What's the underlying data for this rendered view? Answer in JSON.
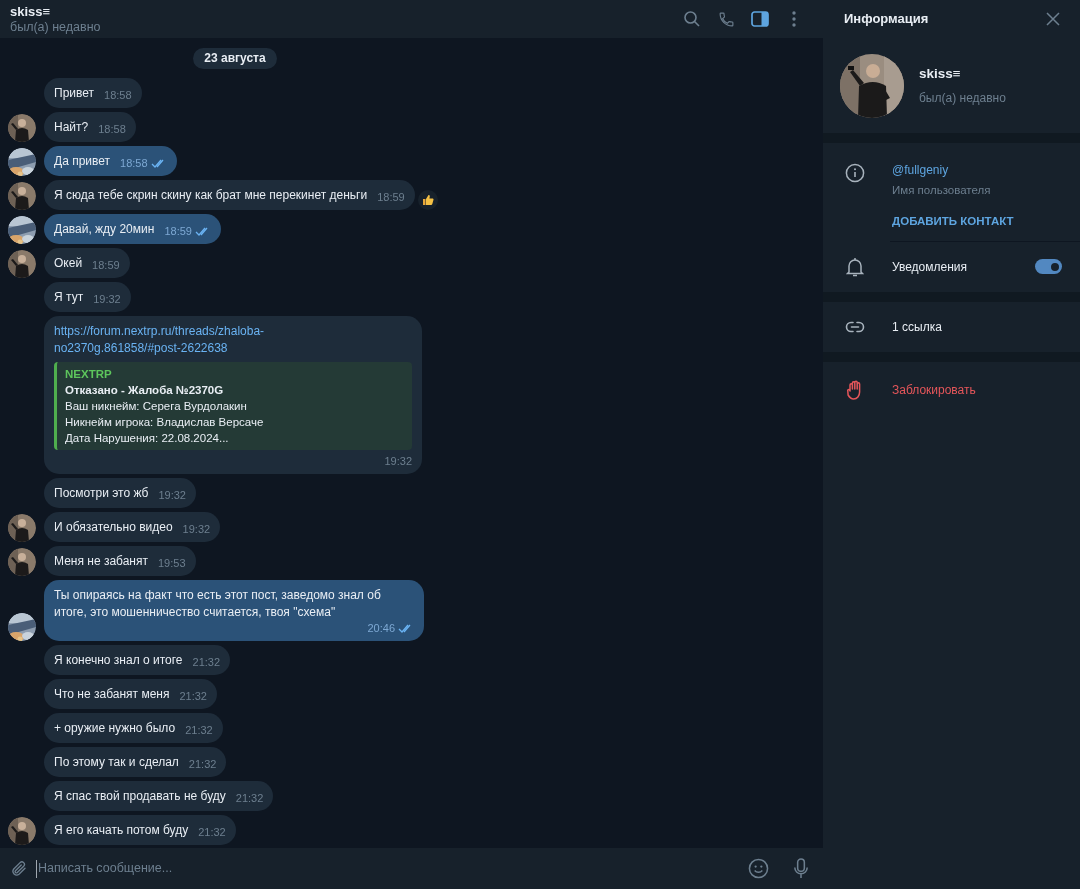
{
  "chat": {
    "title": "skiss≡",
    "status": "был(а) недавно",
    "info_panel_open": true
  },
  "date_badge": "23 августа",
  "messages": [
    {
      "kind": "in",
      "text": "Привет",
      "time": "18:58",
      "avatar": false
    },
    {
      "kind": "in",
      "text": "Найт?",
      "time": "18:58",
      "avatar": true
    },
    {
      "kind": "out",
      "text": "Да привет",
      "time": "18:58",
      "avatar": true,
      "read": true
    },
    {
      "kind": "in",
      "text": "Я сюда тебе скрин скину как брат мне перекинет деньги",
      "time": "18:59",
      "avatar": true,
      "reacted": true
    },
    {
      "kind": "out",
      "text": "Давай, жду 20мин",
      "time": "18:59",
      "avatar": true,
      "read": true
    },
    {
      "kind": "in",
      "text": "Окей",
      "time": "18:59",
      "avatar": true
    },
    {
      "kind": "in",
      "text": "Я тут",
      "time": "19:32",
      "avatar": false
    },
    {
      "kind": "link",
      "url": "https://forum.nextrp.ru/threads/zhaloba-no2370g.861858/#post-2622638",
      "preview": {
        "site": "NEXTRP",
        "title": "Отказано - Жалоба №2370G",
        "lines": [
          "Ваш никнейм: Серега Вурдолакин",
          "Никнейм игрока: Владислав Версаче",
          "Дата Нарушения: 22.08.2024..."
        ]
      },
      "time": "19:32",
      "avatar": false
    },
    {
      "kind": "in",
      "text": "Посмотри это жб",
      "time": "19:32",
      "avatar": false
    },
    {
      "kind": "in",
      "text": "И обязательно видео",
      "time": "19:32",
      "avatar": true
    },
    {
      "kind": "in",
      "text": "Меня не забанят",
      "time": "19:53",
      "avatar": true
    },
    {
      "kind": "out",
      "text": "Ты опираясь на факт что есть этот пост, заведомо знал об итоге, это мошенничество считается, твоя \"схема\"",
      "time": "20:46",
      "avatar": true,
      "read": true
    },
    {
      "kind": "in",
      "text": "Я конечно знал о итоге",
      "time": "21:32",
      "avatar": false
    },
    {
      "kind": "in",
      "text": "Что не забанят меня",
      "time": "21:32",
      "avatar": false
    },
    {
      "kind": "in",
      "text": "+ оружие нужно было",
      "time": "21:32",
      "avatar": false
    },
    {
      "kind": "in",
      "text": "По этому так и сделал",
      "time": "21:32",
      "avatar": false
    },
    {
      "kind": "in",
      "text": "Я спас твой продавать не буду",
      "time": "21:32",
      "avatar": false
    },
    {
      "kind": "in",
      "text": "Я его качать потом буду",
      "time": "21:32",
      "avatar": true
    }
  ],
  "composer": {
    "placeholder": "Написать сообщение..."
  },
  "info_panel": {
    "title": "Информация",
    "name": "skiss≡",
    "status": "был(а) недавно",
    "username": "@fullgeniy",
    "username_label": "Имя пользователя",
    "add_contact": "ДОБАВИТЬ КОНТАКТ",
    "notifications": {
      "label": "Уведомления",
      "on": true
    },
    "links": "1 ссылка",
    "block": "Заблокировать"
  }
}
